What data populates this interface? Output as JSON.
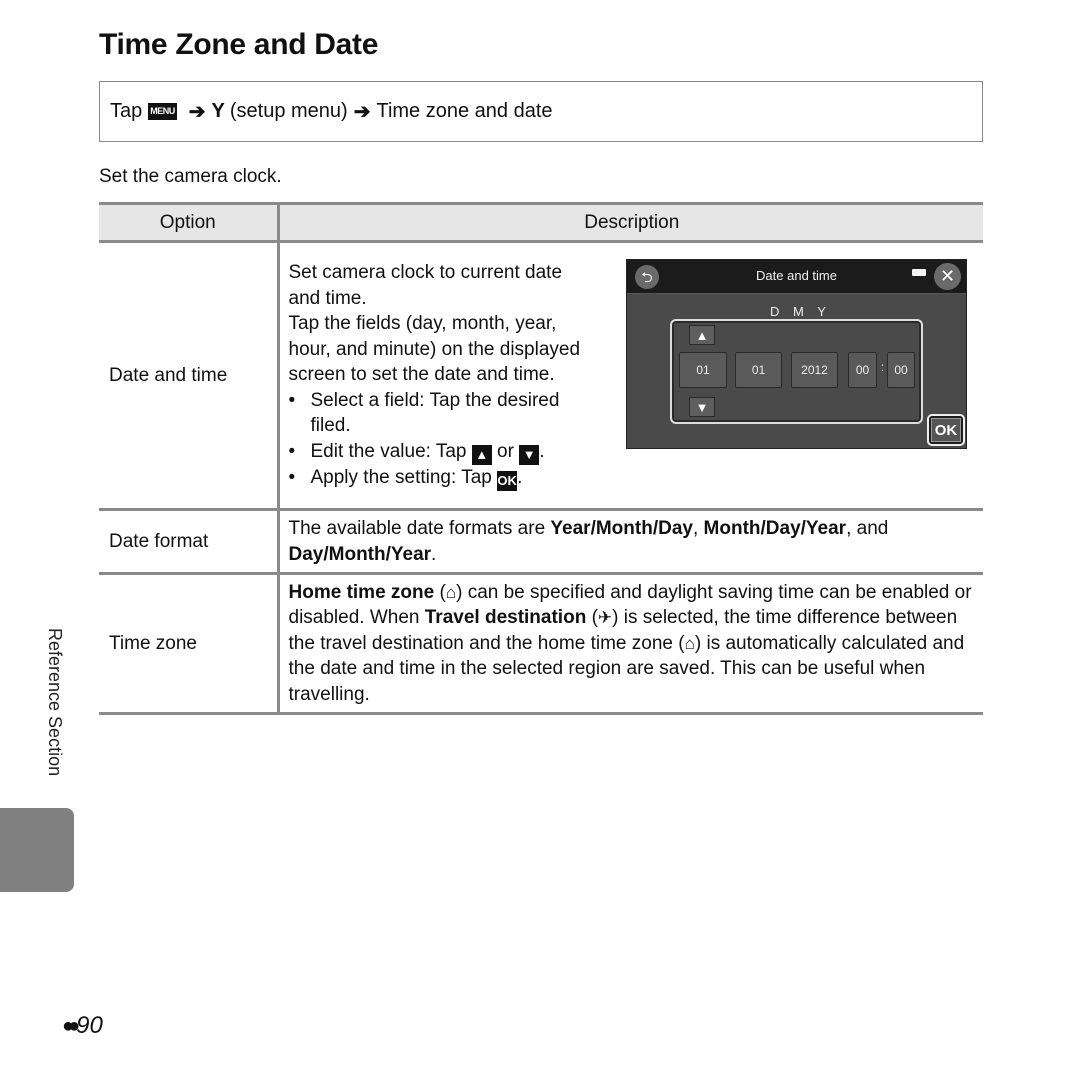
{
  "page": {
    "title": "Time Zone and Date",
    "intro": "Set the camera clock.",
    "side_label": "Reference Section",
    "page_prefix_icon": "binoculars-icon",
    "page_number": "90"
  },
  "nav_path": {
    "tap": "Tap",
    "menu_key": "MENU",
    "arrow": "➔",
    "wrench": "Y",
    "setup_menu": "(setup menu)",
    "target": "Time zone and date"
  },
  "table": {
    "headers": {
      "option": "Option",
      "description": "Description"
    },
    "rows": [
      {
        "option": "Date and time",
        "lines": [
          "Set camera clock to current date and time.",
          "Tap the fields (day, month, year, hour, and minute) on the displayed screen to set the date and time."
        ],
        "bullets": {
          "b1": "Select a field: Tap the desired filed.",
          "b2_pre": "Edit the value: Tap",
          "b2_up": "▲",
          "b2_or": "or",
          "b2_down": "▼",
          "b2_end": ".",
          "b3_pre": "Apply the setting: Tap",
          "b3_ok": "OK",
          "b3_end": "."
        }
      },
      {
        "option": "Date format",
        "pre": "The available date formats are",
        "f1": "Year/Month/Day",
        "sep1": ",",
        "f2": "Month/Day/Year",
        "sep2": ", and",
        "f3": "Day/Month/Year",
        "end": "."
      },
      {
        "option": "Time zone",
        "home_label": "Home time zone",
        "home_icon": "⌂",
        "t1": "can be specified and daylight saving time can be enabled or disabled. When",
        "travel_label": "Travel destination",
        "travel_icon": "✈",
        "t2": "is selected, the time difference between the travel destination and the home time zone",
        "t3": "is automatically calculated and the date and time in the selected region are saved. This can be useful when travelling."
      }
    ]
  },
  "camera_screen": {
    "title": "Date and time",
    "back_icon": "⮌",
    "close_icon": "✕",
    "order_label": "D M Y",
    "up": "▲",
    "down": "▼",
    "fields": {
      "day": "01",
      "month": "01",
      "year": "2012",
      "hour": "00",
      "minute": "00"
    },
    "colon": ":",
    "ok": "OK"
  }
}
